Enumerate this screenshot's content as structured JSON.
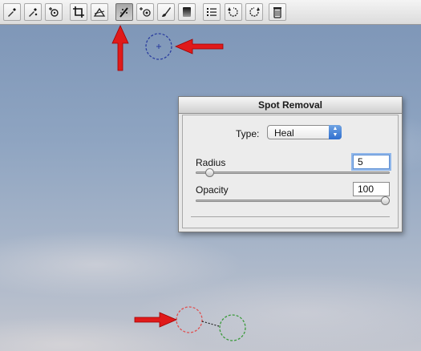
{
  "toolbar": {
    "tools": [
      {
        "name": "zoom-tool",
        "icon": "eyedropper-icon",
        "active": false
      },
      {
        "name": "color-sampler-tool",
        "icon": "color-sampler-icon",
        "active": false
      },
      {
        "name": "target-adjustment-tool",
        "icon": "target-adjustment-icon",
        "active": false
      },
      {
        "name": "crop-tool",
        "icon": "crop-icon",
        "active": false
      },
      {
        "name": "straighten-tool",
        "icon": "straighten-icon",
        "active": false
      },
      {
        "name": "spot-removal-tool",
        "icon": "spot-removal-icon",
        "active": true
      },
      {
        "name": "red-eye-tool",
        "icon": "red-eye-icon",
        "active": false
      },
      {
        "name": "adjustment-brush-tool",
        "icon": "brush-icon",
        "active": false
      },
      {
        "name": "graduated-filter-tool",
        "icon": "graduated-filter-icon",
        "active": false
      },
      {
        "name": "preferences-tool",
        "icon": "list-icon",
        "active": false
      },
      {
        "name": "rotate-left-tool",
        "icon": "rotate-ccw-icon",
        "active": false
      },
      {
        "name": "rotate-right-tool",
        "icon": "rotate-cw-icon",
        "active": false
      },
      {
        "name": "delete-tool",
        "icon": "trash-icon",
        "active": false
      }
    ]
  },
  "panel": {
    "title": "Spot Removal",
    "type_label": "Type:",
    "type_value": "Heal",
    "radius_label": "Radius",
    "radius_value": "5",
    "radius_fraction": 0.05,
    "opacity_label": "Opacity",
    "opacity_value": "100",
    "opacity_fraction": 1.0
  },
  "colors": {
    "arrow": "#e01a1a",
    "cursor_circle": "#2b3ea0",
    "source_circle": "#e05050",
    "target_circle": "#3a9a3a"
  }
}
